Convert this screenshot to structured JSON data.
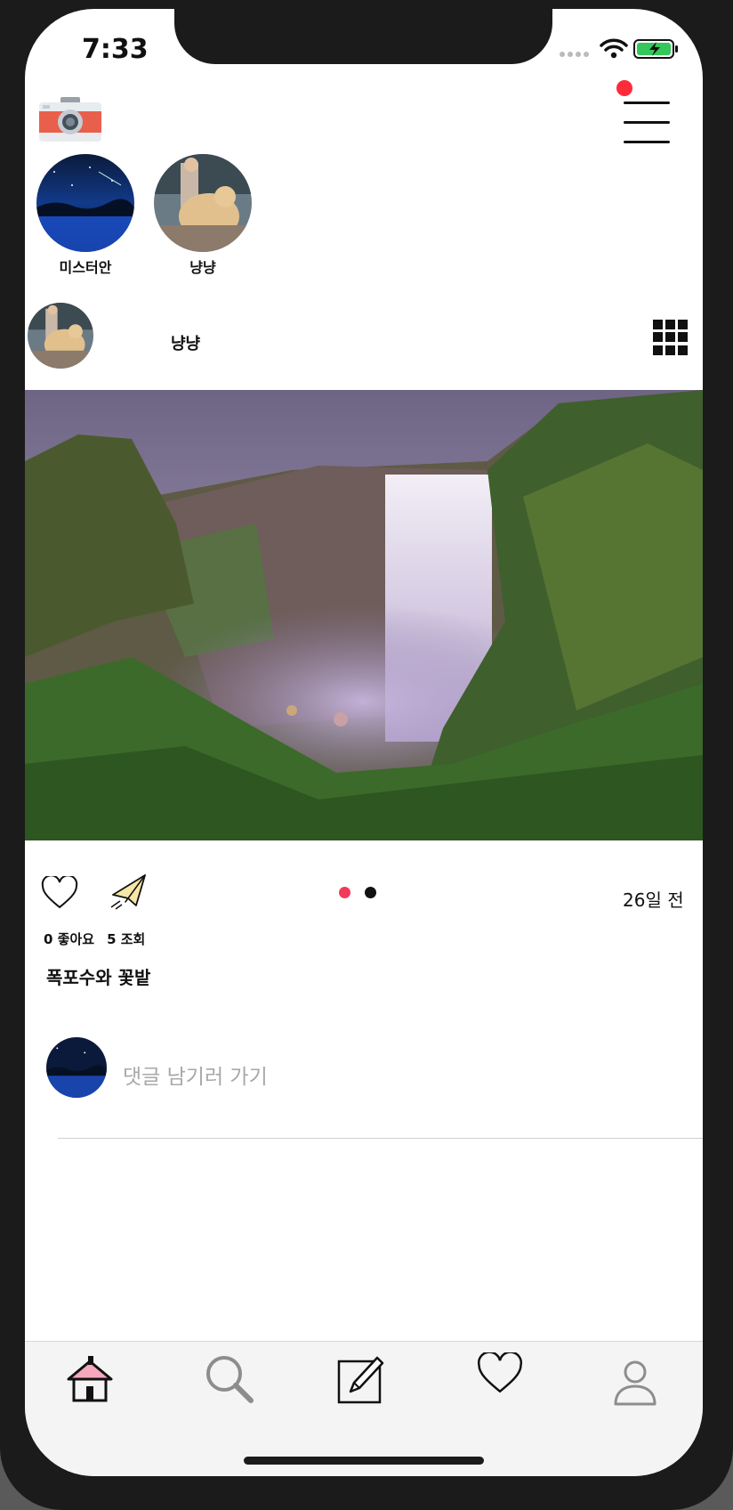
{
  "status_bar": {
    "time": "7:33"
  },
  "stories": [
    {
      "name": "미스터안",
      "avatar": "night-sky-avatar"
    },
    {
      "name": "냥냥",
      "avatar": "dog-owner-avatar"
    }
  ],
  "post": {
    "username": "냥냥",
    "image": "waterfall-photo",
    "age": "26일 전",
    "likes": "0 좋아요",
    "views": "5 조회",
    "caption": "폭포수와 꽃밭",
    "carousel": {
      "count": 2,
      "active_index": 0,
      "active_color": "#f2395a",
      "inactive_color": "#111111"
    }
  },
  "comment": {
    "placeholder": "댓글 남기러 가기"
  },
  "icons": {
    "logo": "camera-icon",
    "menu": "hamburger-menu-icon",
    "grid": "grid-view-icon",
    "like": "heart-icon",
    "share": "paper-plane-icon",
    "tabs": [
      "home-icon",
      "search-icon",
      "edit-icon",
      "heart-icon",
      "profile-icon"
    ]
  },
  "colors": {
    "notification_dot": "#ff2b3a",
    "home_roof": "#f7a8bd"
  }
}
